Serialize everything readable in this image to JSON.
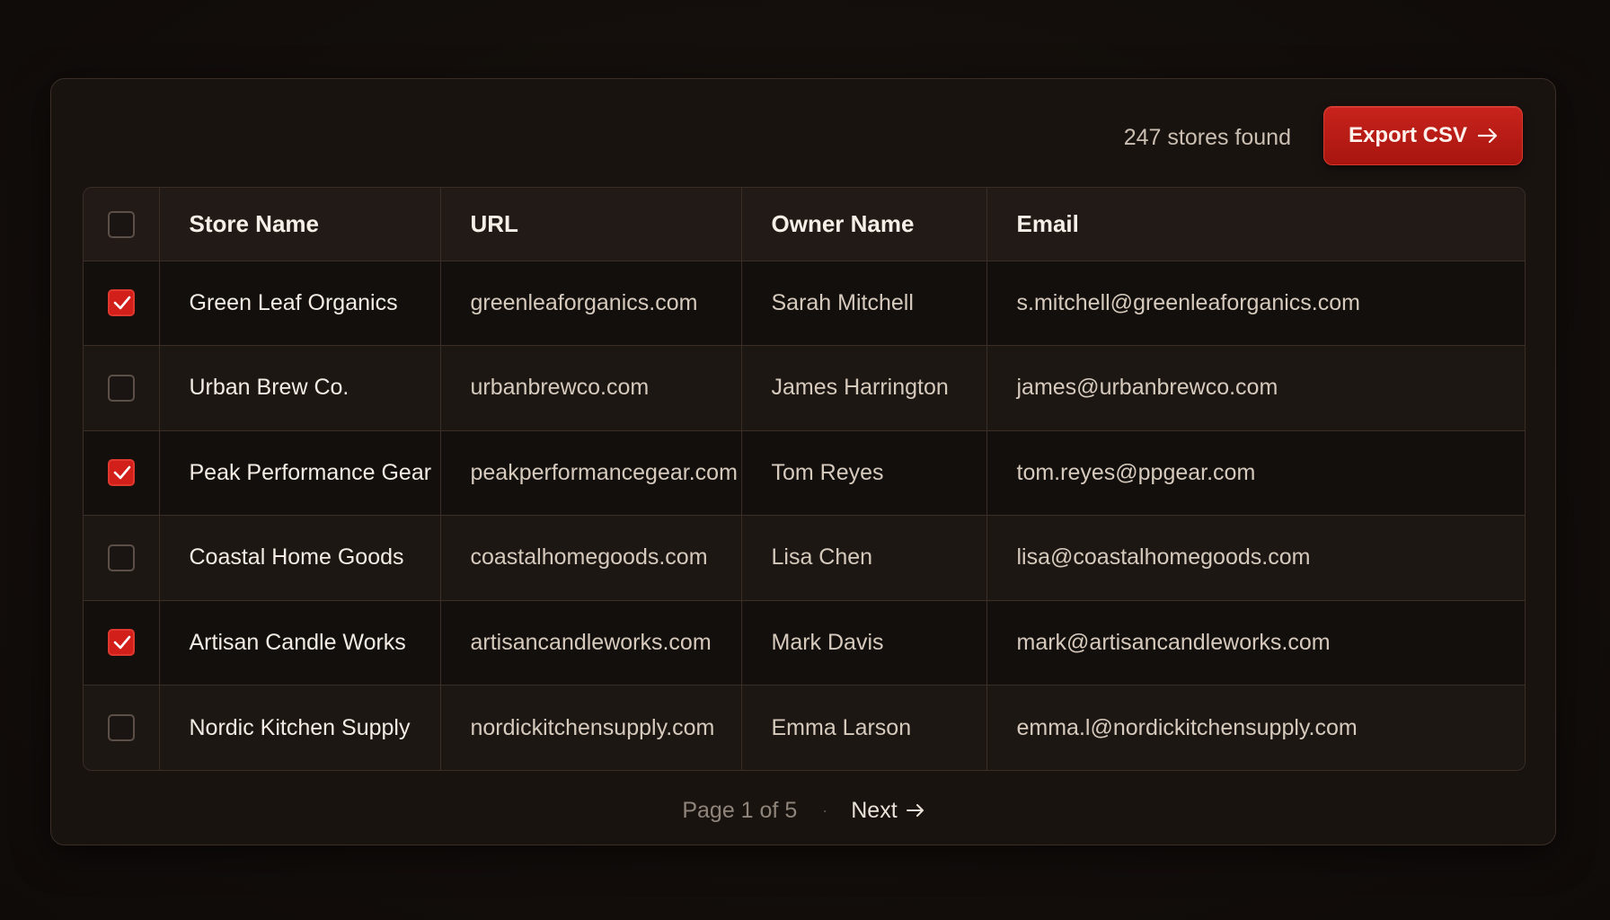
{
  "toolbar": {
    "result_count": "247 stores found",
    "export_label": "Export CSV",
    "export_icon": "arrow-right-icon"
  },
  "table": {
    "columns": [
      "Store Name",
      "URL",
      "Owner Name",
      "Email"
    ],
    "select_all_checked": false,
    "rows": [
      {
        "checked": true,
        "store": "Green Leaf Organics",
        "url": "greenleaforganics.com",
        "owner": "Sarah Mitchell",
        "email": "s.mitchell@greenleaforganics.com"
      },
      {
        "checked": false,
        "store": "Urban Brew Co.",
        "url": "urbanbrewco.com",
        "owner": "James Harrington",
        "email": "james@urbanbrewco.com"
      },
      {
        "checked": true,
        "store": "Peak Performance Gear",
        "url": "peakperformancegear.com",
        "owner": "Tom Reyes",
        "email": "tom.reyes@ppgear.com"
      },
      {
        "checked": false,
        "store": "Coastal Home Goods",
        "url": "coastalhomegoods.com",
        "owner": "Lisa Chen",
        "email": "lisa@coastalhomegoods.com"
      },
      {
        "checked": true,
        "store": "Artisan Candle Works",
        "url": "artisancandleworks.com",
        "owner": "Mark Davis",
        "email": "mark@artisancandleworks.com"
      },
      {
        "checked": false,
        "store": "Nordic Kitchen Supply",
        "url": "nordickitchensupply.com",
        "owner": "Emma Larson",
        "email": "emma.l@nordickitchensupply.com"
      }
    ]
  },
  "pagination": {
    "page_label": "Page 1 of 5",
    "separator": "·",
    "next_label": "Next",
    "next_icon": "arrow-right-icon"
  },
  "colors": {
    "accent": "#c8231c",
    "background": "#140f0c",
    "border": "#3a2e27"
  }
}
